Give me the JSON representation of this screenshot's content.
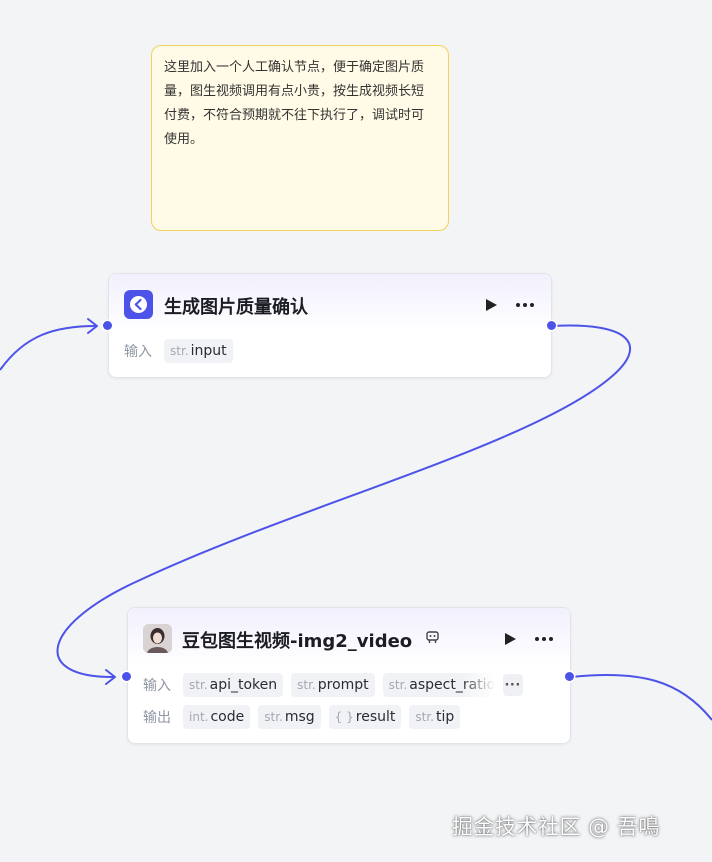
{
  "note": {
    "text": "这里加入一个人工确认节点，便于确定图片质量，图生视频调用有点小贵，按生成视频长短付费，不符合预期就不往下执行了，调试时可使用。"
  },
  "node_confirm": {
    "title": "生成图片质量确认",
    "icon": "confirm-arrow-icon",
    "input_label": "输入",
    "inputs": [
      {
        "type": "str.",
        "name": "input"
      }
    ]
  },
  "node_video": {
    "title": "豆包图生视频-img2_video",
    "icon": "avatar-thumbnail",
    "badge_icon": "plugin-icon",
    "input_label": "输入",
    "inputs": [
      {
        "type": "str.",
        "name": "api_token"
      },
      {
        "type": "str.",
        "name": "prompt"
      },
      {
        "type": "str.",
        "name": "aspect_ratio"
      }
    ],
    "more_inputs": "···",
    "output_label": "输出",
    "outputs": [
      {
        "type": "int.",
        "name": "code"
      },
      {
        "type": "str.",
        "name": "msg"
      },
      {
        "type": "{ }",
        "name": "result"
      },
      {
        "type": "str.",
        "name": "tip"
      }
    ]
  },
  "colors": {
    "accent": "#4d53e8",
    "note_bg": "#fffbe6",
    "note_border": "#f3d35c",
    "canvas_bg": "#f2f4f6"
  },
  "watermark": "掘金技术社区 @ 吾鳴"
}
